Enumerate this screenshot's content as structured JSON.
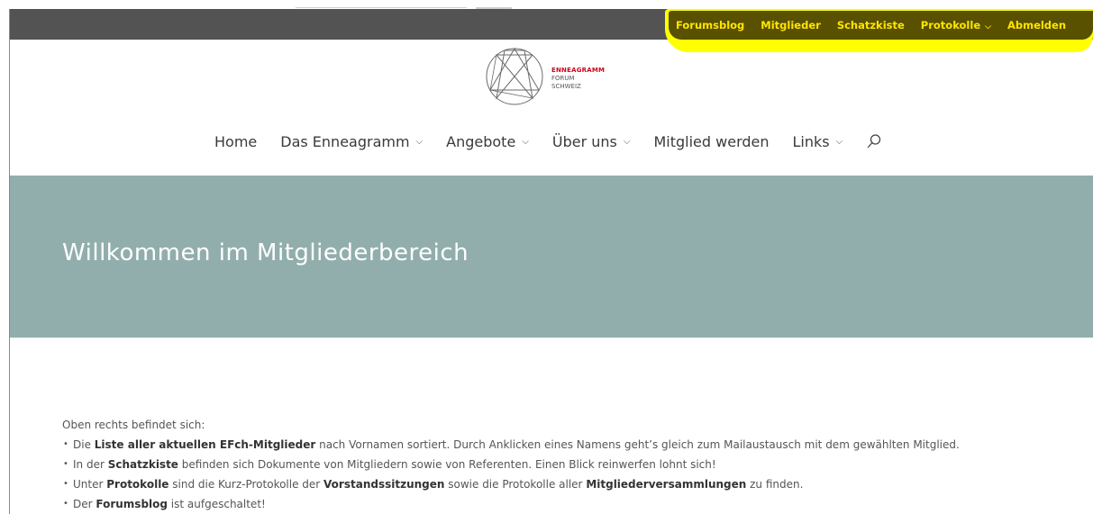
{
  "topbar": {
    "items": [
      {
        "label": "Forumsblog"
      },
      {
        "label": "Mitglieder"
      },
      {
        "label": "Schatzkiste"
      },
      {
        "label": "Protokolle"
      },
      {
        "label": "Abmelden"
      }
    ]
  },
  "logo": {
    "line1": "ENNEAGRAMM",
    "line2": "FORUM",
    "line3": "SCHWEIZ"
  },
  "mainnav": {
    "items": [
      {
        "label": "Home"
      },
      {
        "label": "Das Enneagramm"
      },
      {
        "label": "Angebote"
      },
      {
        "label": "Über uns"
      },
      {
        "label": "Mitglied werden"
      },
      {
        "label": "Links"
      }
    ]
  },
  "hero": {
    "title": "Willkommen im Mitgliederbereich"
  },
  "content": {
    "intro": "Oben rechts befindet sich:",
    "bullets": [
      {
        "pre": "Die ",
        "b1": "Liste aller aktuellen EFch-Mitglieder",
        "post": " nach Vornamen sortiert. Durch Anklicken eines Namens geht’s gleich zum Mailaustausch mit dem gewählten Mitglied."
      },
      {
        "pre": "In der ",
        "b1": "Schatzkiste",
        "post": " befinden sich Dokumente von Mitgliedern sowie von Referenten. Einen Blick reinwerfen lohnt sich!"
      },
      {
        "pre": "Unter ",
        "b1": "Protokolle",
        "mid1": " sind die Kurz-Protokolle der ",
        "b2": "Vorstandssitzungen",
        "mid2": " sowie die Protokolle aller ",
        "b3": "Mitgliederversammlungen",
        "post": " zu finden."
      },
      {
        "pre": "Der ",
        "b1": "Forumsblog",
        "post": " ist aufgeschaltet!"
      }
    ]
  },
  "colors": {
    "topbar_bg": "#535353",
    "highlight": "#ffff00",
    "topnav_text": "#ffe600",
    "hero_bg": "#91aeac",
    "brand_red": "#d0021b"
  }
}
